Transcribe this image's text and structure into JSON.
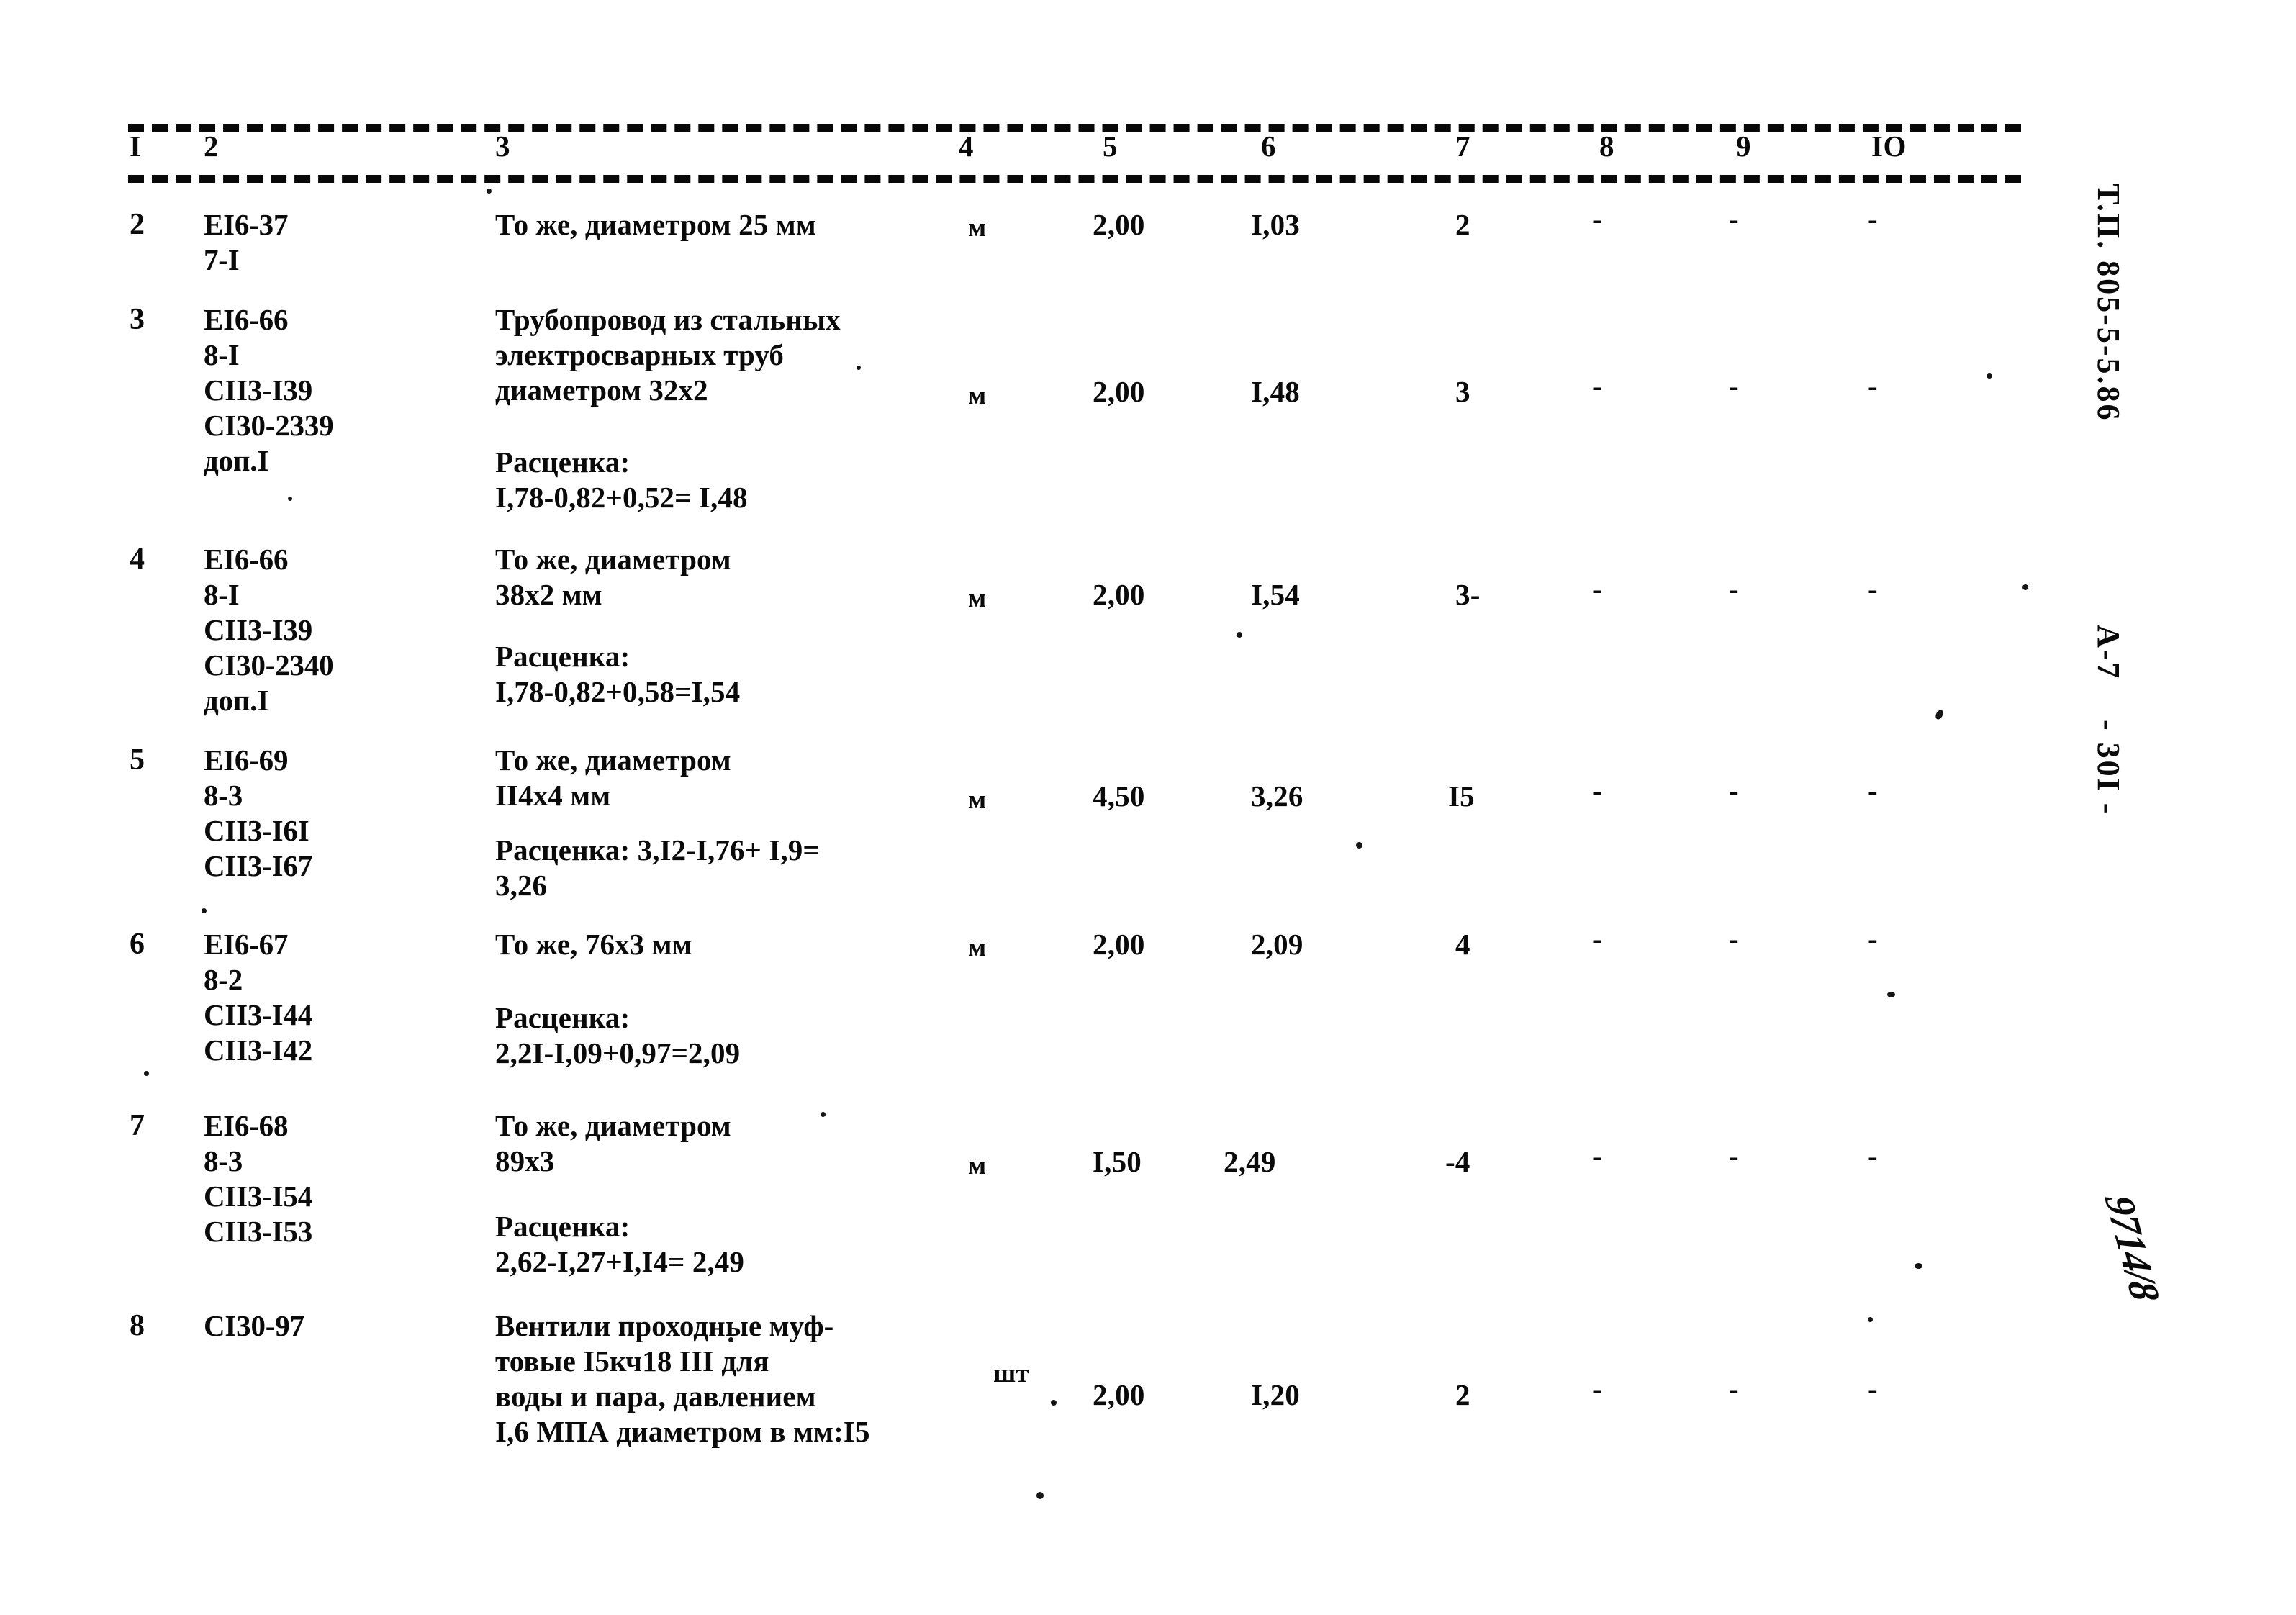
{
  "document": {
    "type": "estimate-table-scan",
    "language": "ru"
  },
  "table": {
    "headers": [
      "I",
      "2",
      "3",
      "4",
      "5",
      "6",
      "7",
      "8",
      "9",
      "IO"
    ],
    "rows": [
      {
        "num": "2",
        "code": "EI6-37\n7-I",
        "description": "То же, диаметром 25 мм",
        "unit": "м",
        "col5": "2,00",
        "col6": "I,03",
        "col7": "2",
        "col8": "-",
        "col9": "-",
        "col10": "-",
        "extra": ""
      },
      {
        "num": "3",
        "code": "EI6-66\n8-I\nCII3-I39\nCI30-2339\nдоп.I",
        "description": "Трубопровод из стальных\nэлектросварных труб\nдиаметром 32х2",
        "unit": "м",
        "col5": "2,00",
        "col6": "I,48",
        "col7": "3",
        "col8": "-",
        "col9": "-",
        "col10": "-",
        "extra": "Расценка:\nI,78-0,82+0,52= I,48"
      },
      {
        "num": "4",
        "code": "EI6-66\n8-I\nCII3-I39\nCI30-2340\nдоп.I",
        "description": "То же, диаметром\n38х2 мм",
        "unit": "м",
        "col5": "2,00",
        "col6": "I,54",
        "col7": "3-",
        "col8": "-",
        "col9": "-",
        "col10": "-",
        "extra": "Расценка:\nI,78-0,82+0,58=I,54"
      },
      {
        "num": "5",
        "code": "EI6-69\n8-3\nCII3-I6I\nCII3-I67",
        "description": "То же, диаметром\nII4х4 мм",
        "unit": "м",
        "col5": "4,50",
        "col6": "3,26",
        "col7": "I5",
        "col8": "-",
        "col9": "-",
        "col10": "-",
        "extra": "Расценка: 3,I2-I,76+ I,9=\n3,26"
      },
      {
        "num": "6",
        "code": "EI6-67\n8-2\nCII3-I44\nCII3-I42",
        "description": "То же, 76х3 мм",
        "unit": "м",
        "col5": "2,00",
        "col6": "2,09",
        "col7": "4",
        "col8": "-",
        "col9": "-",
        "col10": "-",
        "extra": "Расценка:\n2,2I-I,09+0,97=2,09"
      },
      {
        "num": "7",
        "code": "EI6-68\n8-3\nCII3-I54\nCII3-I53",
        "description": "То же, диаметром\n89х3",
        "unit": "м",
        "col5": "I,50",
        "col6": "2,49",
        "col7": "-4",
        "col8": "-",
        "col9": "-",
        "col10": "-",
        "extra": "Расценка:\n2,62-I,27+I,I4= 2,49"
      },
      {
        "num": "8",
        "code": "CI30-97",
        "description": "Вентили проходные муф-\nтовые I5кч18 III для\nводы и пара, давлением\nI,6 МПА диаметром в мм:I5",
        "unit": "шт",
        "col5": "2,00",
        "col6": "I,20",
        "col7": "2",
        "col8": "-",
        "col9": "-",
        "col10": "-",
        "extra": ""
      }
    ]
  },
  "margin_stamps": {
    "project_code": "Т.П. 805-5-5.86",
    "sheet_code": "А-7",
    "page_number": "- 30I -",
    "handwritten_number": "9714/8"
  }
}
